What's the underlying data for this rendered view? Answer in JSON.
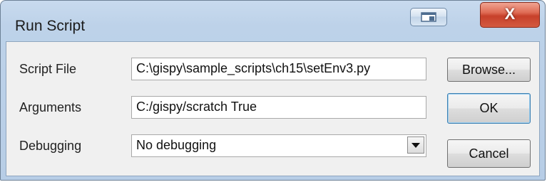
{
  "window": {
    "title": "Run Script",
    "close_glyph": "X",
    "restore_icon": "restore-icon"
  },
  "form": {
    "script_file_label": "Script File",
    "script_file_value": "C:\\gispy\\sample_scripts\\ch15\\setEnv3.py",
    "arguments_label": "Arguments",
    "arguments_value": "C:/gispy/scratch True",
    "debugging_label": "Debugging",
    "debugging_value": "No debugging"
  },
  "buttons": {
    "browse": "Browse...",
    "ok": "OK",
    "cancel": "Cancel"
  }
}
